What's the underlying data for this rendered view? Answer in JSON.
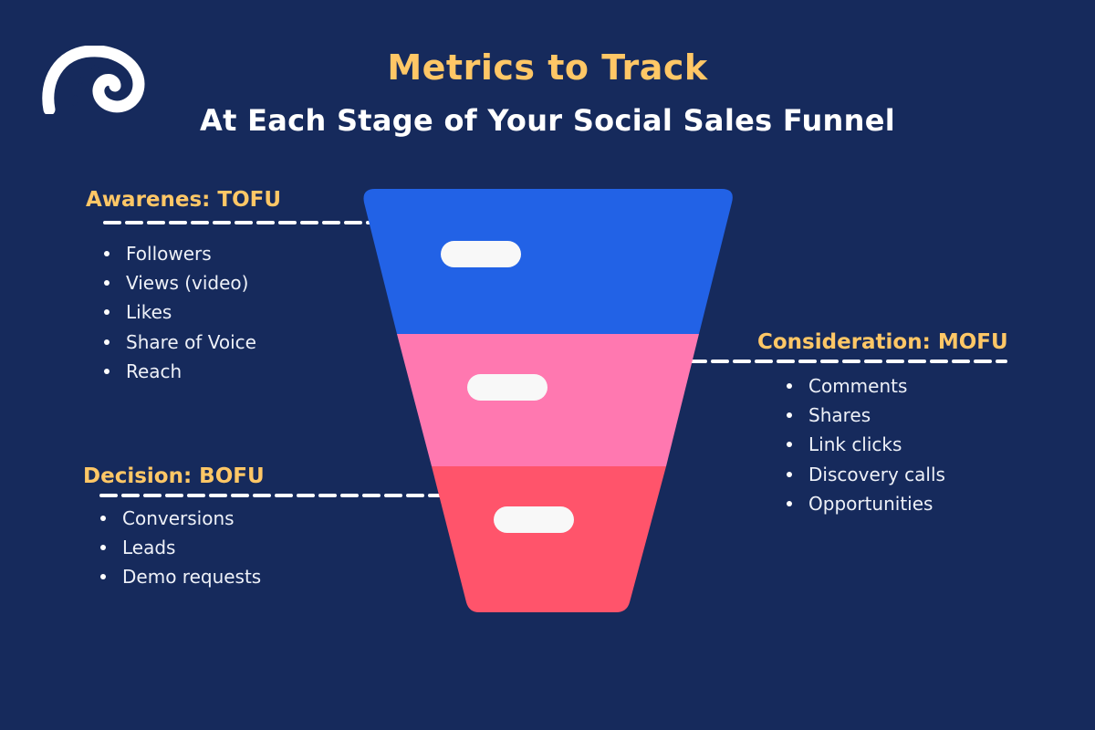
{
  "header": {
    "title": "Metrics to Track",
    "subtitle": "At Each Stage of Your Social Sales Funnel"
  },
  "logo": {
    "icon": "spiral-logo-icon"
  },
  "colors": {
    "background": "#162a5c",
    "heading": "#ffc766",
    "text": "#ffffff",
    "tofu": "#2262e6",
    "mofu": "#ff78b0",
    "bofu": "#ff546b",
    "pill": "#f8f8f8"
  },
  "stages": [
    {
      "id": "tofu",
      "heading": "Awarenes: TOFU",
      "metrics": [
        "Followers",
        "Views (video)",
        "Likes",
        "Share of Voice",
        "Reach"
      ]
    },
    {
      "id": "mofu",
      "heading": "Consideration: MOFU",
      "metrics": [
        "Comments",
        "Shares",
        "Link clicks",
        "Discovery calls",
        "Opportunities"
      ]
    },
    {
      "id": "bofu",
      "heading": "Decision: BOFU",
      "metrics": [
        "Conversions",
        "Leads",
        "Demo requests"
      ]
    }
  ]
}
